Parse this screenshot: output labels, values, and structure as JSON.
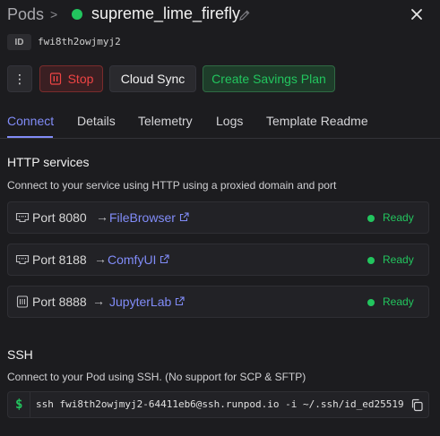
{
  "header": {
    "breadcrumb_root": "Pods",
    "separator": ">",
    "pod_name": "supreme_lime_firefly",
    "status_color": "#22c55e"
  },
  "id_row": {
    "badge": "ID",
    "value": "fwi8th2owjmyj2"
  },
  "actions": {
    "menu_label": "⋮",
    "stop_label": "Stop",
    "cloud_sync_label": "Cloud Sync",
    "savings_label": "Create Savings Plan"
  },
  "tabs": [
    {
      "label": "Connect",
      "active": true
    },
    {
      "label": "Details",
      "active": false
    },
    {
      "label": "Telemetry",
      "active": false
    },
    {
      "label": "Logs",
      "active": false
    },
    {
      "label": "Template Readme",
      "active": false
    }
  ],
  "http": {
    "title": "HTTP services",
    "description": "Connect to your service using HTTP using a proxied domain and port",
    "services": [
      {
        "icon": "ethernet-port-icon",
        "port": "Port 8080",
        "arrow": "→",
        "link": "FileBrowser",
        "status": "Ready"
      },
      {
        "icon": "ethernet-port-icon",
        "port": "Port 8188",
        "arrow": "→",
        "link": "ComfyUI",
        "status": "Ready"
      },
      {
        "icon": "cpu-chip-icon",
        "port": "Port 8888",
        "arrow": "→",
        "link": "JupyterLab",
        "status": "Ready"
      }
    ]
  },
  "ssh": {
    "title": "SSH",
    "description": "Connect to your Pod using SSH. (No support for SCP & SFTP)",
    "prompt": "$",
    "command": "ssh fwi8th2owjmyj2-64411eb6@ssh.runpod.io -i ~/.ssh/id_ed25519"
  },
  "colors": {
    "accent": "#818cf8",
    "success": "#22c55e",
    "danger": "#ef4444",
    "background": "#1c1c1f"
  }
}
